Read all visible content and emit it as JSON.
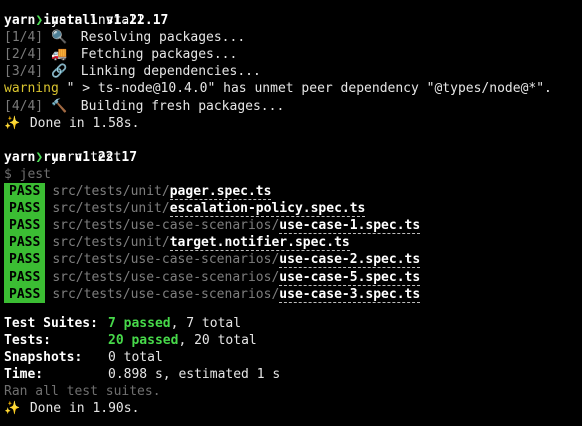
{
  "session": {
    "cmd1": {
      "arrow": "❯",
      "command": "yarn install"
    },
    "install_header": "yarn install v1.22.17",
    "install_steps": [
      {
        "step": "[1/4]",
        "emoji": "🔍",
        "text": " Resolving packages..."
      },
      {
        "step": "[2/4]",
        "emoji": "🚚",
        "text": " Fetching packages..."
      },
      {
        "step": "[3/4]",
        "emoji": "🔗",
        "text": " Linking dependencies..."
      }
    ],
    "warning": {
      "label": "warning",
      "text": " \" > ts-node@10.4.0\" has unmet peer dependency \"@types/node@*\"."
    },
    "install_step4": {
      "step": "[4/4]",
      "emoji": "🔨",
      "text": " Building fresh packages..."
    },
    "install_done": {
      "emoji": "✨",
      "text": " Done in 1.58s."
    },
    "cmd2": {
      "arrow": "❯",
      "command": "yarn test"
    },
    "test_header": "yarn run v1.22.17",
    "jest_cmd": "$ jest",
    "results": [
      {
        "badge": "PASS",
        "dir": "src/tests/unit/",
        "file": "pager.spec.ts"
      },
      {
        "badge": "PASS",
        "dir": "src/tests/unit/",
        "file": "escalation-policy.spec.ts"
      },
      {
        "badge": "PASS",
        "dir": "src/tests/use-case-scenarios/",
        "file": "use-case-1.spec.ts"
      },
      {
        "badge": "PASS",
        "dir": "src/tests/unit/",
        "file": "target.notifier.spec.ts"
      },
      {
        "badge": "PASS",
        "dir": "src/tests/use-case-scenarios/",
        "file": "use-case-2.spec.ts"
      },
      {
        "badge": "PASS",
        "dir": "src/tests/use-case-scenarios/",
        "file": "use-case-5.spec.ts"
      },
      {
        "badge": "PASS",
        "dir": "src/tests/use-case-scenarios/",
        "file": "use-case-3.spec.ts"
      }
    ],
    "summary": {
      "suites": {
        "label": "Test Suites:",
        "passed": "7 passed",
        "rest": ", 7 total"
      },
      "tests": {
        "label": "Tests:",
        "passed": "20 passed",
        "rest": ", 20 total"
      },
      "snapshots": {
        "label": "Snapshots:",
        "value": "0 total"
      },
      "time": {
        "label": "Time:",
        "value": "0.898 s, estimated 1 s"
      }
    },
    "ran_all": "Ran all test suites.",
    "test_done": {
      "emoji": "✨",
      "text": " Done in 1.90s."
    }
  },
  "colors": {
    "background": "#000000",
    "pass_badge": "#3bbd33",
    "passed_text": "#47d94a",
    "warning": "#d9c42f"
  }
}
